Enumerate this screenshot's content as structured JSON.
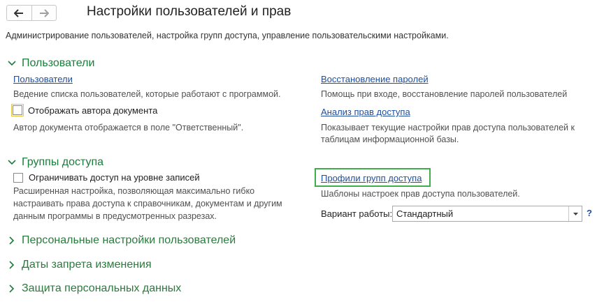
{
  "header": {
    "title": "Настройки пользователей и прав",
    "description": "Администрирование пользователей, настройка групп доступа, управление пользовательскими настройками."
  },
  "sections": {
    "users": {
      "title": "Пользователи",
      "users_link": "Пользователи",
      "users_hint": "Ведение списка пользователей, которые работают с программой.",
      "author_checkbox_label": "Отображать автора документа",
      "author_hint": "Автор документа отображается в поле \"Ответственный\".",
      "password_link": "Восстановление паролей",
      "password_hint": "Помощь при входе, восстановление паролей пользователей",
      "rights_link": "Анализ прав доступа",
      "rights_hint_1": "Показывает текущие настройки прав доступа пользователей к",
      "rights_hint_2": "таблицам информационной базы."
    },
    "access_groups": {
      "title": "Группы доступа",
      "restrict_checkbox_label": "Ограничивать доступ на уровне записей",
      "restrict_hint_1": "Расширенная настройка, позволяющая максимально гибко",
      "restrict_hint_2": "настраивать права доступа к справочникам, документам и другим",
      "restrict_hint_3": "данным программы в предусмотренных разрезах.",
      "profiles_link": "Профили групп доступа",
      "profiles_hint": "Шаблоны настроек прав доступа пользователей.",
      "mode_label": "Вариант работы:",
      "mode_value": "Стандартный",
      "help": "?"
    },
    "collapsed": {
      "personal_settings": "Персональные настройки пользователей",
      "change_prohibition_dates": "Даты запрета изменения",
      "personal_data_protection": "Защита персональных данных"
    }
  },
  "icons": [
    "back-arrow-icon",
    "forward-arrow-icon",
    "chevron-down-icon",
    "chevron-right-icon",
    "dropdown-arrow-icon"
  ],
  "colors": {
    "section_title": "#1b7d3a",
    "link": "#1e4e9e",
    "highlight_box": "#3fae4a",
    "focus_border": "#e8c23a"
  }
}
